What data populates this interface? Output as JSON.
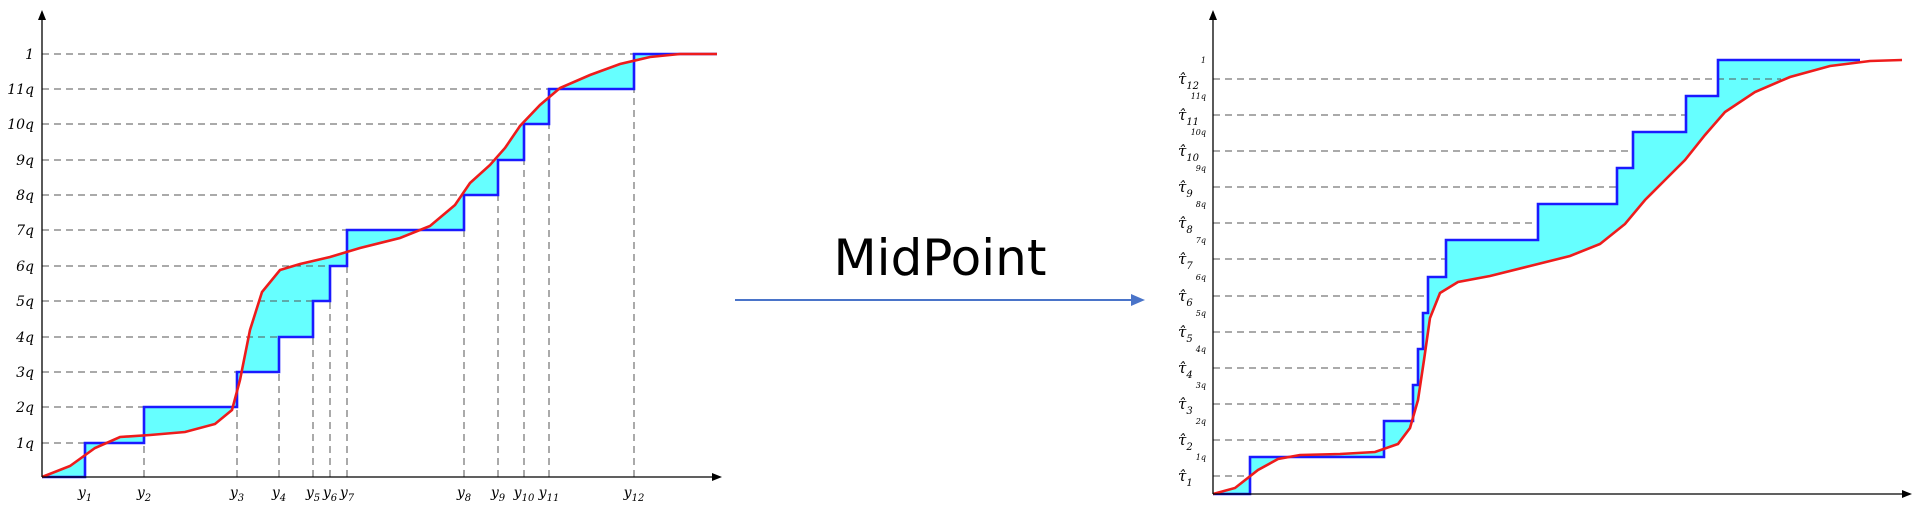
{
  "left_plot": {
    "y_ticks": [
      "1q",
      "2q",
      "3q",
      "4q",
      "5q",
      "6q",
      "7q",
      "8q",
      "9q",
      "10q",
      "11q",
      "1"
    ],
    "x_ticks": [
      {
        "base": "y",
        "sub": "1"
      },
      {
        "base": "y",
        "sub": "2"
      },
      {
        "base": "y",
        "sub": "3"
      },
      {
        "base": "y",
        "sub": "4"
      },
      {
        "base": "y",
        "sub": "5"
      },
      {
        "base": "y",
        "sub": "6"
      },
      {
        "base": "y",
        "sub": "7"
      },
      {
        "base": "y",
        "sub": "8"
      },
      {
        "base": "y",
        "sub": "9"
      },
      {
        "base": "y",
        "sub": "10"
      },
      {
        "base": "y",
        "sub": "11"
      },
      {
        "base": "y",
        "sub": "12"
      }
    ]
  },
  "arrow": {
    "label": "MidPoint",
    "color": "#4a74c9"
  },
  "right_plot": {
    "y_ticks": [
      "1q",
      "2q",
      "3q",
      "4q",
      "5q",
      "6q",
      "7q",
      "8q",
      "9q",
      "10q",
      "11q",
      "1"
    ],
    "tau_labels": [
      {
        "base": "τ̂",
        "sub": "1"
      },
      {
        "base": "τ̂",
        "sub": "2"
      },
      {
        "base": "τ̂",
        "sub": "3"
      },
      {
        "base": "τ̂",
        "sub": "4"
      },
      {
        "base": "τ̂",
        "sub": "5"
      },
      {
        "base": "τ̂",
        "sub": "6"
      },
      {
        "base": "τ̂",
        "sub": "7"
      },
      {
        "base": "τ̂",
        "sub": "8"
      },
      {
        "base": "τ̂",
        "sub": "9"
      },
      {
        "base": "τ̂",
        "sub": "10"
      },
      {
        "base": "τ̂",
        "sub": "11"
      },
      {
        "base": "τ̂",
        "sub": "12"
      }
    ]
  },
  "colors": {
    "step": "#1a1aff",
    "curve": "#ee1c1c",
    "fill": "#66ffff",
    "grid": "#555555"
  }
}
